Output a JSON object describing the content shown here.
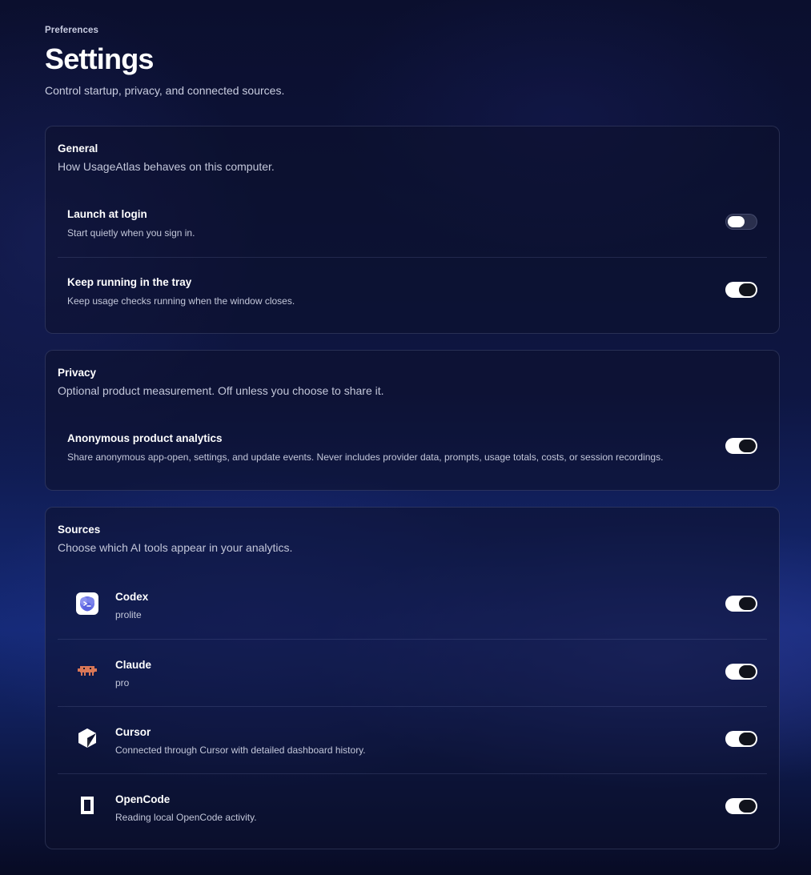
{
  "header": {
    "eyebrow": "Preferences",
    "title": "Settings",
    "subtitle": "Control startup, privacy, and connected sources."
  },
  "general": {
    "title": "General",
    "description": "How UsageAtlas behaves on this computer.",
    "items": [
      {
        "label": "Launch at login",
        "description": "Start quietly when you sign in.",
        "enabled": false
      },
      {
        "label": "Keep running in the tray",
        "description": "Keep usage checks running when the window closes.",
        "enabled": true
      }
    ]
  },
  "privacy": {
    "title": "Privacy",
    "description": "Optional product measurement. Off unless you choose to share it.",
    "items": [
      {
        "label": "Anonymous product analytics",
        "description": "Share anonymous app-open, settings, and update events. Never includes provider data, prompts, usage totals, costs, or session recordings.",
        "enabled": true
      }
    ]
  },
  "sources": {
    "title": "Sources",
    "description": "Choose which AI tools appear in your analytics.",
    "items": [
      {
        "name": "Codex",
        "detail": "prolite",
        "icon": "codex-icon",
        "enabled": true
      },
      {
        "name": "Claude",
        "detail": "pro",
        "icon": "claude-icon",
        "enabled": true
      },
      {
        "name": "Cursor",
        "detail": "Connected through Cursor with detailed dashboard history.",
        "icon": "cursor-icon",
        "enabled": true
      },
      {
        "name": "OpenCode",
        "detail": "Reading local OpenCode activity.",
        "icon": "opencode-icon",
        "enabled": true
      }
    ]
  },
  "colors": {
    "toggle_on": "#ffffff",
    "toggle_knob_on": "#11131c",
    "toggle_off": "#2a2f4d",
    "claude_brand": "#d97757",
    "codex_brand": "#6b73e8"
  }
}
